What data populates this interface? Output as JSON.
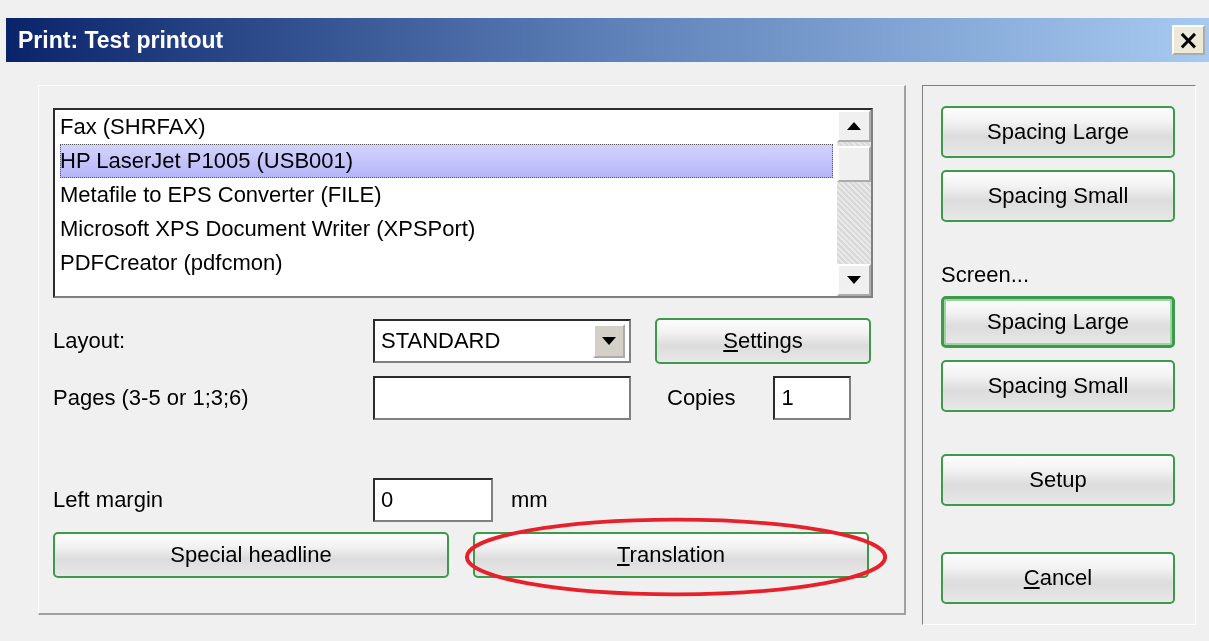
{
  "window": {
    "title": "Print: Test printout",
    "close": "×"
  },
  "printers": [
    {
      "name": "Fax (SHRFAX)",
      "selected": false
    },
    {
      "name": "HP LaserJet P1005 (USB001)",
      "selected": true
    },
    {
      "name": "Metafile to EPS Converter (FILE)",
      "selected": false
    },
    {
      "name": "Microsoft XPS Document Writer (XPSPort)",
      "selected": false
    },
    {
      "name": "PDFCreator (pdfcmon)",
      "selected": false
    }
  ],
  "layout": {
    "label": "Layout:",
    "value": "STANDARD"
  },
  "settings_button": {
    "label": "Settings",
    "underline_first": true
  },
  "pages": {
    "label": "Pages (3-5 or 1;3;6)"
  },
  "copies": {
    "label": "Copies",
    "value": "1"
  },
  "left_margin": {
    "label": "Left margin",
    "value": "0",
    "unit": "mm"
  },
  "bottom_buttons": [
    {
      "label": "Special headline",
      "circled": false
    },
    {
      "label": "Translation",
      "underline_first": true,
      "circled": true
    }
  ],
  "side": {
    "print_buttons": [
      {
        "label": "Spacing Large",
        "default": false
      },
      {
        "label": "Spacing Small",
        "default": false
      }
    ],
    "screen_label": "Screen...",
    "screen_buttons": [
      {
        "label": "Spacing Large",
        "default": true
      },
      {
        "label": "Spacing Small",
        "default": false
      }
    ],
    "setup": {
      "label": "Setup"
    },
    "cancel": {
      "label": "Cancel",
      "underline_first": true
    }
  }
}
